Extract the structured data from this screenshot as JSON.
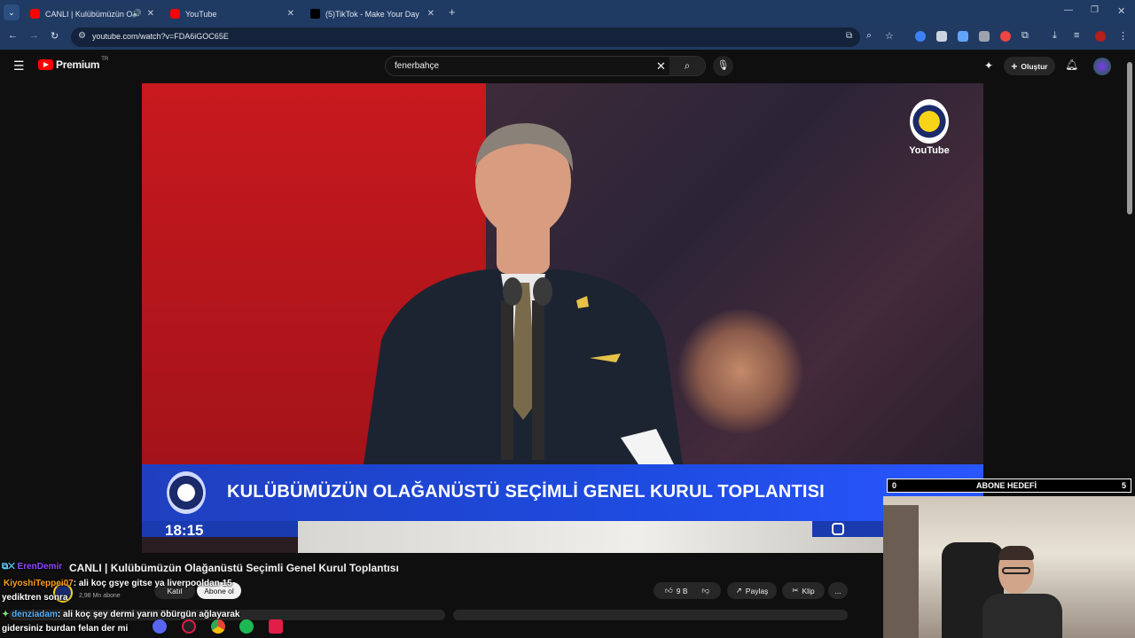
{
  "browser": {
    "tabs": [
      {
        "label": "CANLI | Kulübümüzün O",
        "active": true
      },
      {
        "label": "YouTube",
        "active": false
      },
      {
        "label": "(5)TikTok - Make Your Day",
        "active": false
      }
    ],
    "url": "youtube.com/watch?v=FDA6iGOC65E"
  },
  "youtube": {
    "brand": "Premium",
    "region": "TR",
    "search_value": "fenerbahçe",
    "create_label": "Oluştur"
  },
  "video": {
    "logo_text": "YouTube",
    "lower_third_title": "KULÜBÜMÜZÜN OLAĞANÜSTÜ SEÇİMLİ GENEL KURUL TOPLANTISI",
    "clock": "18:15"
  },
  "overlay": {
    "goal_left": "0",
    "goal_label": "ABONE HEDEFİ",
    "goal_right": "5"
  },
  "watch": {
    "title": "CANLI | Kulübümüzün Olağanüstü Seçimli Genel Kurul Toplantısı",
    "channel_subs": "2,98 Mn abone",
    "join_label": "Katıl",
    "subscribe_label": "Abone ol",
    "likes": "9 B",
    "share_label": "Paylaş",
    "clip_label": "Klip",
    "more": "..."
  },
  "chat": [
    {
      "user": "ErenDemir",
      "text": ""
    },
    {
      "user": "KiyoshiTeppei07",
      "text": ": ali koç gsye gitse ya liverpooldan 15"
    },
    {
      "user": "",
      "text": "yediktren sonra"
    },
    {
      "user": "denziadam",
      "text": ": ali koç şey dermi yarın öbürgün ağlayarak"
    },
    {
      "user": "",
      "text": "gidersiniz burdan felan der mi"
    }
  ],
  "colors": {
    "tab_strip": "#1f3a63",
    "lower_third_blue": "#1e4be0",
    "yt_red": "#ff0000",
    "background": "#0f0f0f"
  }
}
